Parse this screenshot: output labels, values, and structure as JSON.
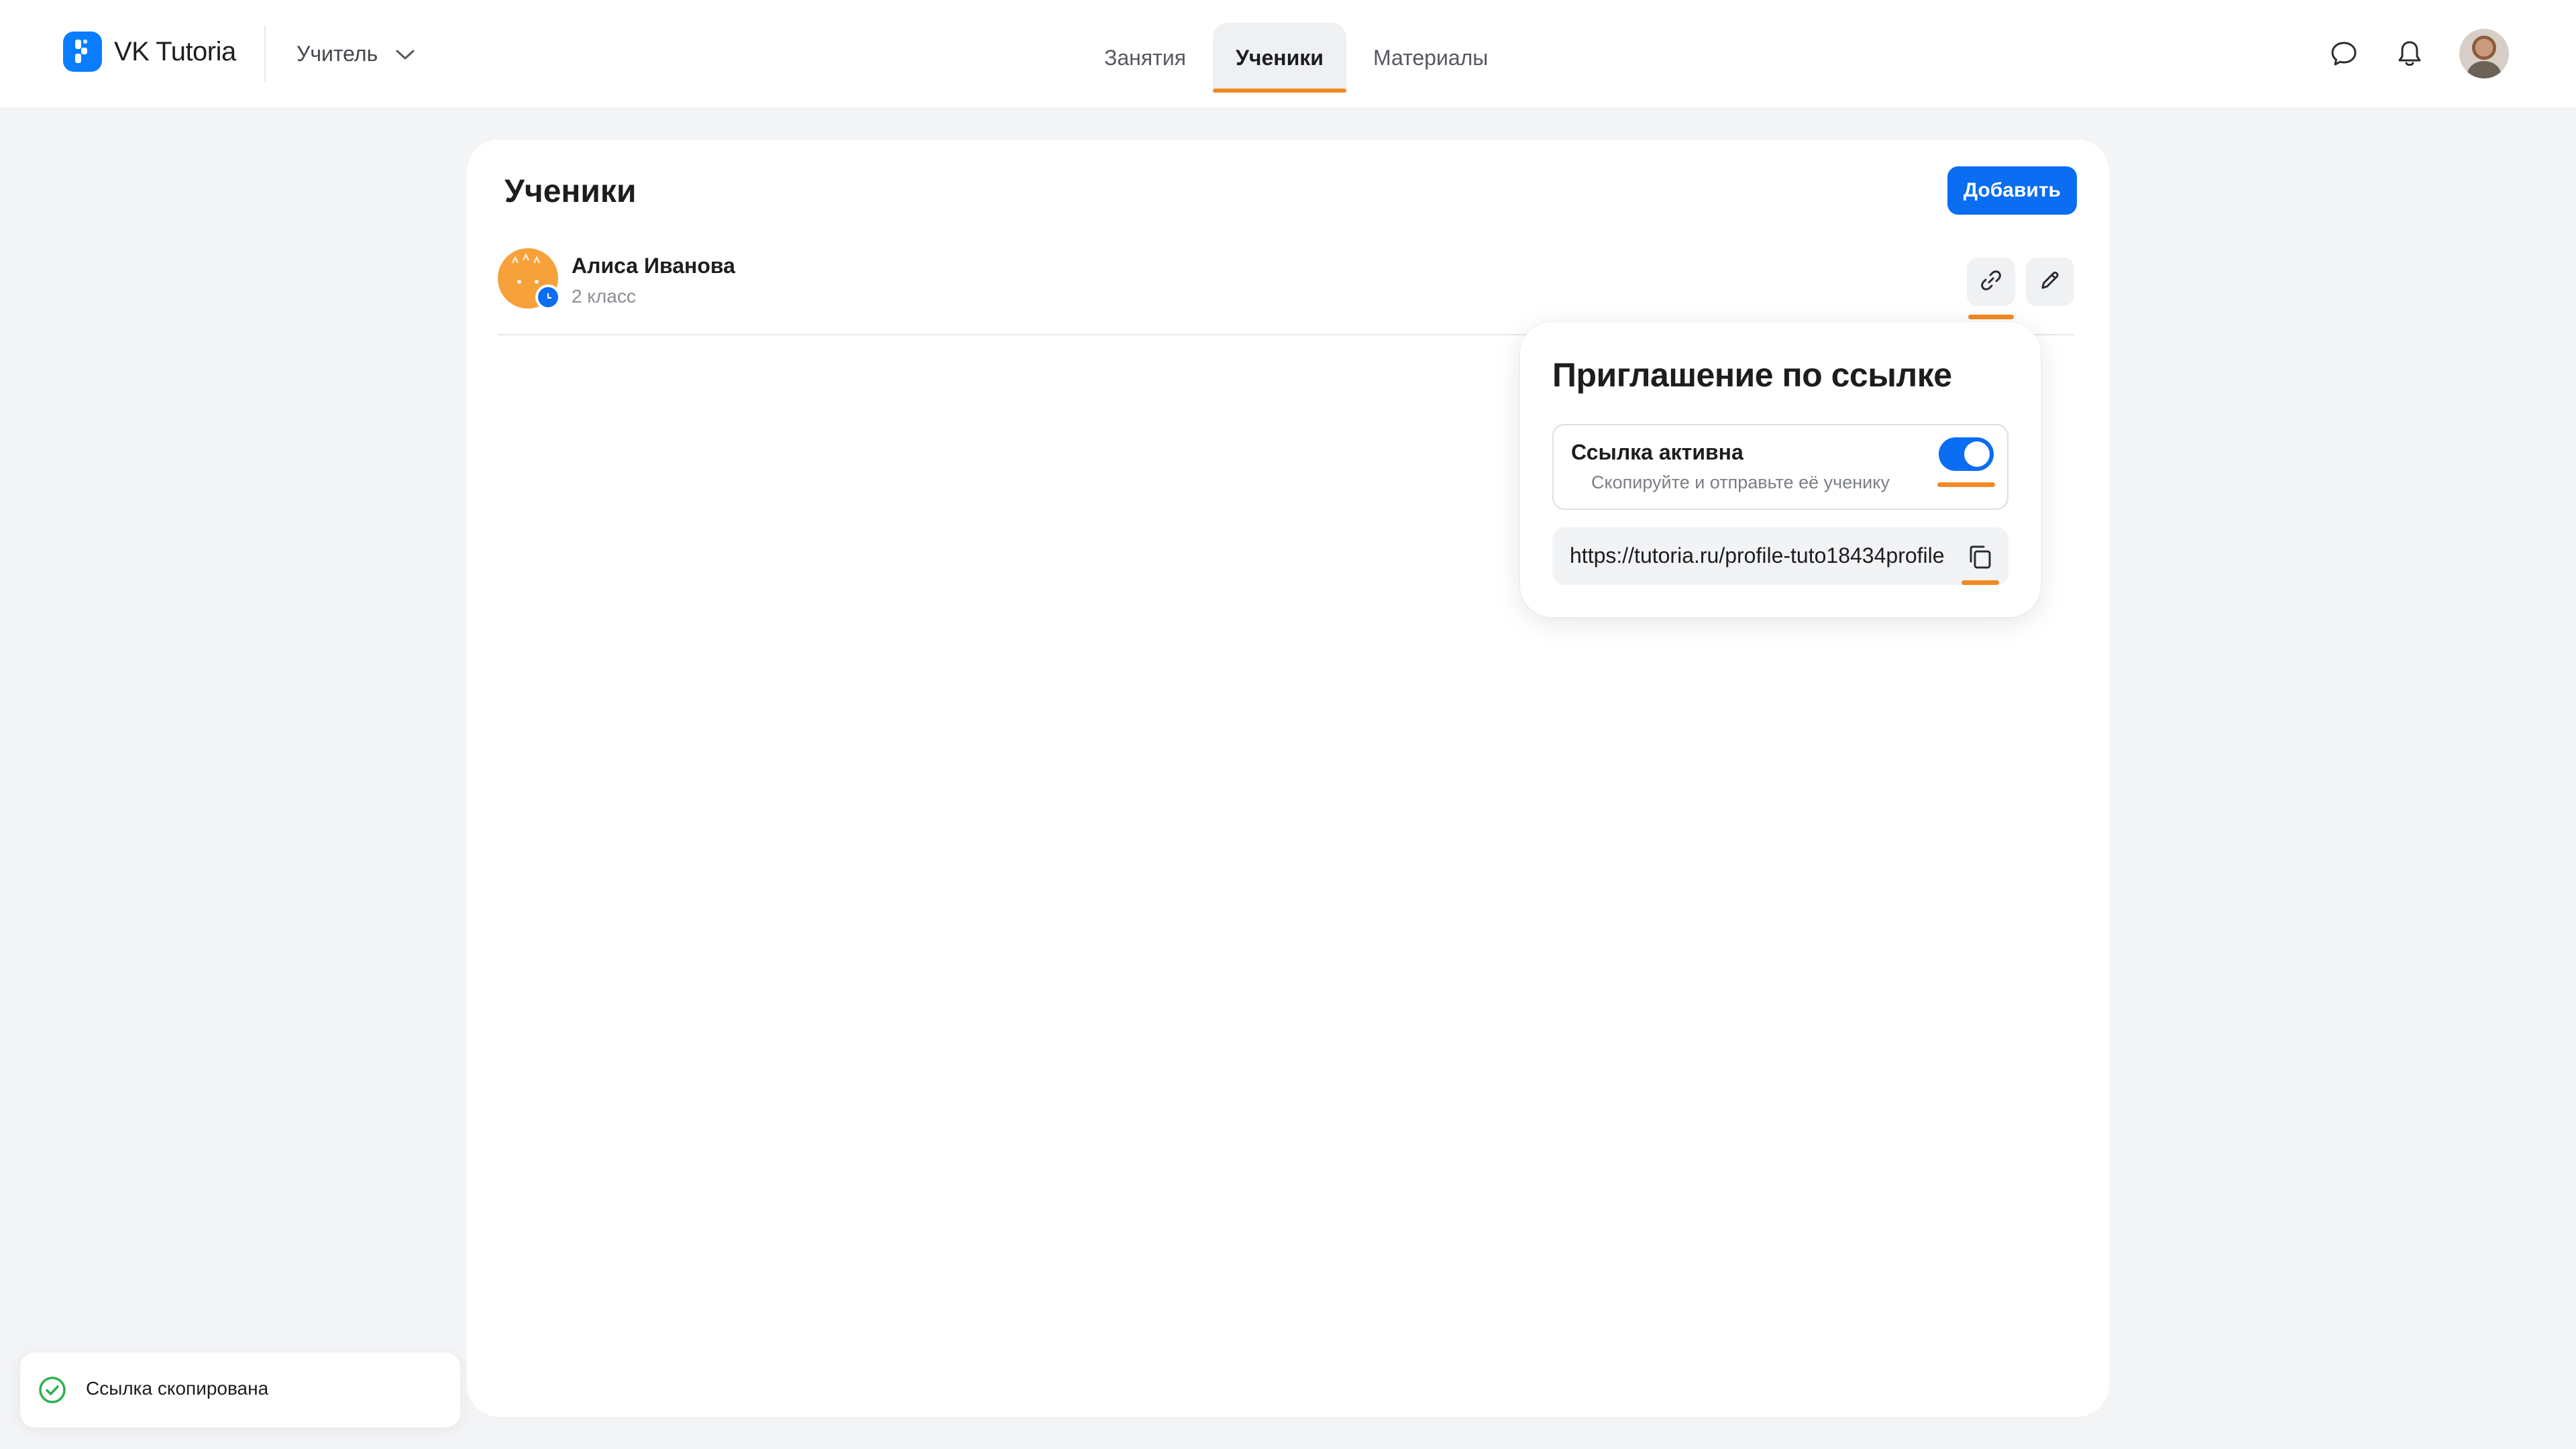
{
  "app": {
    "brand": "VK Tutoria",
    "role": "Учитель"
  },
  "nav": {
    "tabs": [
      {
        "label": "Занятия",
        "active": false
      },
      {
        "label": "Ученики",
        "active": true
      },
      {
        "label": "Материалы",
        "active": false
      }
    ]
  },
  "header": {
    "icons": [
      "chat-icon",
      "bell-icon",
      "avatar"
    ]
  },
  "page": {
    "title": "Ученики",
    "add_label": "Добавить"
  },
  "students": [
    {
      "name": "Алиса Иванова",
      "grade": "2 класс"
    }
  ],
  "invite": {
    "title": "Приглашение по ссылке",
    "active_label": "Ссылка активна",
    "active_hint": "Скопируйте и отправьте её ученику",
    "active": true,
    "url": "https://tutoria.ru/profile-tuto18434profile"
  },
  "toast": {
    "text": "Ссылка скопирована"
  },
  "colors": {
    "accent": "#0a6df2",
    "highlight": "#f08a24",
    "success": "#2bb24c"
  }
}
